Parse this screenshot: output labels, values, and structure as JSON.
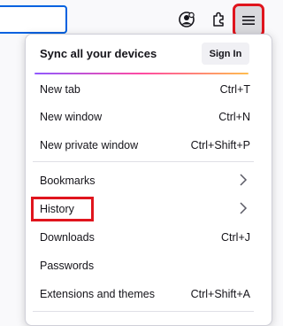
{
  "toolbar": {
    "account_icon": "account-icon",
    "extensions_icon": "extensions-icon",
    "menu_icon": "hamburger-menu-icon"
  },
  "menu": {
    "sync": {
      "label": "Sync all your devices",
      "button": "Sign In"
    },
    "items": [
      {
        "label": "New tab",
        "shortcut": "Ctrl+T"
      },
      {
        "label": "New window",
        "shortcut": "Ctrl+N"
      },
      {
        "label": "New private window",
        "shortcut": "Ctrl+Shift+P"
      },
      {
        "label": "Bookmarks",
        "shortcut": ""
      },
      {
        "label": "History",
        "shortcut": ""
      },
      {
        "label": "Downloads",
        "shortcut": "Ctrl+J"
      },
      {
        "label": "Passwords",
        "shortcut": ""
      },
      {
        "label": "Extensions and themes",
        "shortcut": "Ctrl+Shift+A"
      }
    ]
  },
  "colors": {
    "highlight": "#e0151d",
    "focus_ring": "#0061e0"
  }
}
